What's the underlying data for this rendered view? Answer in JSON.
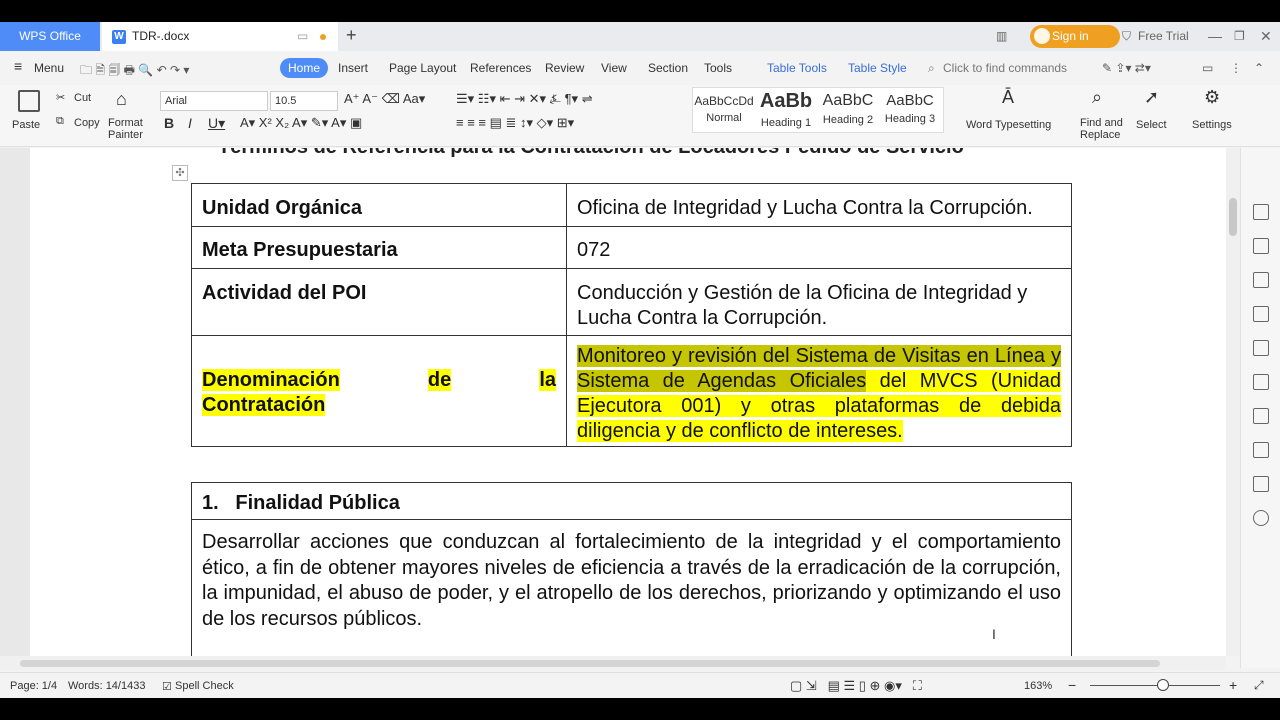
{
  "titlebar": {
    "app_tab": "WPS Office",
    "doc_tab": "TDR-.docx",
    "sign_in": "Sign in",
    "free_trial": "Free Trial"
  },
  "menu": {
    "menu_label": "Menu",
    "tabs": [
      "Home",
      "Insert",
      "Page Layout",
      "References",
      "Review",
      "View",
      "Section",
      "Tools",
      "Table Tools",
      "Table Style"
    ],
    "search_placeholder": "Click to find commands"
  },
  "ribbon": {
    "paste": "Paste",
    "cut": "Cut",
    "copy": "Copy",
    "format_painter_1": "Format",
    "format_painter_2": "Painter",
    "font_name": "Arial",
    "font_size": "10.5",
    "styles": [
      {
        "preview": "AaBbCcDd",
        "label": "Normal"
      },
      {
        "preview": "AaBb",
        "label": "Heading 1"
      },
      {
        "preview": "AaBbC",
        "label": "Heading 2"
      },
      {
        "preview": "AaBbC",
        "label": "Heading 3"
      }
    ],
    "word_typesetting": "Word Typesetting",
    "find_replace_1": "Find and",
    "find_replace_2": "Replace",
    "select": "Select",
    "settings": "Settings"
  },
  "document": {
    "cut_title": "Términos de Referencia para la Contratación de Locadores Pedido de Servicio",
    "table": [
      {
        "label": "Unidad Orgánica",
        "value": "Oficina de Integridad y Lucha Contra la Corrupción."
      },
      {
        "label": "Meta Presupuestaria",
        "value": "072"
      },
      {
        "label": "Actividad del POI",
        "value": "Conducción y Gestión de la Oficina de Integridad y Lucha Contra la Corrupción."
      },
      {
        "label_a": "Denominación",
        "label_b": "de",
        "label_c": "la",
        "label_d": "Contratación",
        "value_a": "Monitoreo y revisión del Sistema de Visitas en Línea y Sistema de Agendas Oficiales",
        "value_b": " del MVCS (Unidad Ejecutora 001) y otras plataformas de debida diligencia y de conflicto de intereses."
      }
    ],
    "section_number": "1.",
    "section_title": "Finalidad Pública",
    "section_body": "Desarrollar acciones que conduzcan al fortalecimiento de la integridad y el comportamiento ético, a fin de obtener mayores niveles de eficiencia a través de la erradicación de la corrupción, la impunidad, el abuso de poder, y el atropello de los derechos, priorizando y optimizando el uso de los recursos públicos."
  },
  "status": {
    "page": "Page: 1/4",
    "words": "Words: 14/1433",
    "spell_check": "Spell Check",
    "zoom": "163%"
  },
  "colors": {
    "accent": "#4f8cf7",
    "highlight": "#ffff00",
    "signin": "#f0a020"
  }
}
